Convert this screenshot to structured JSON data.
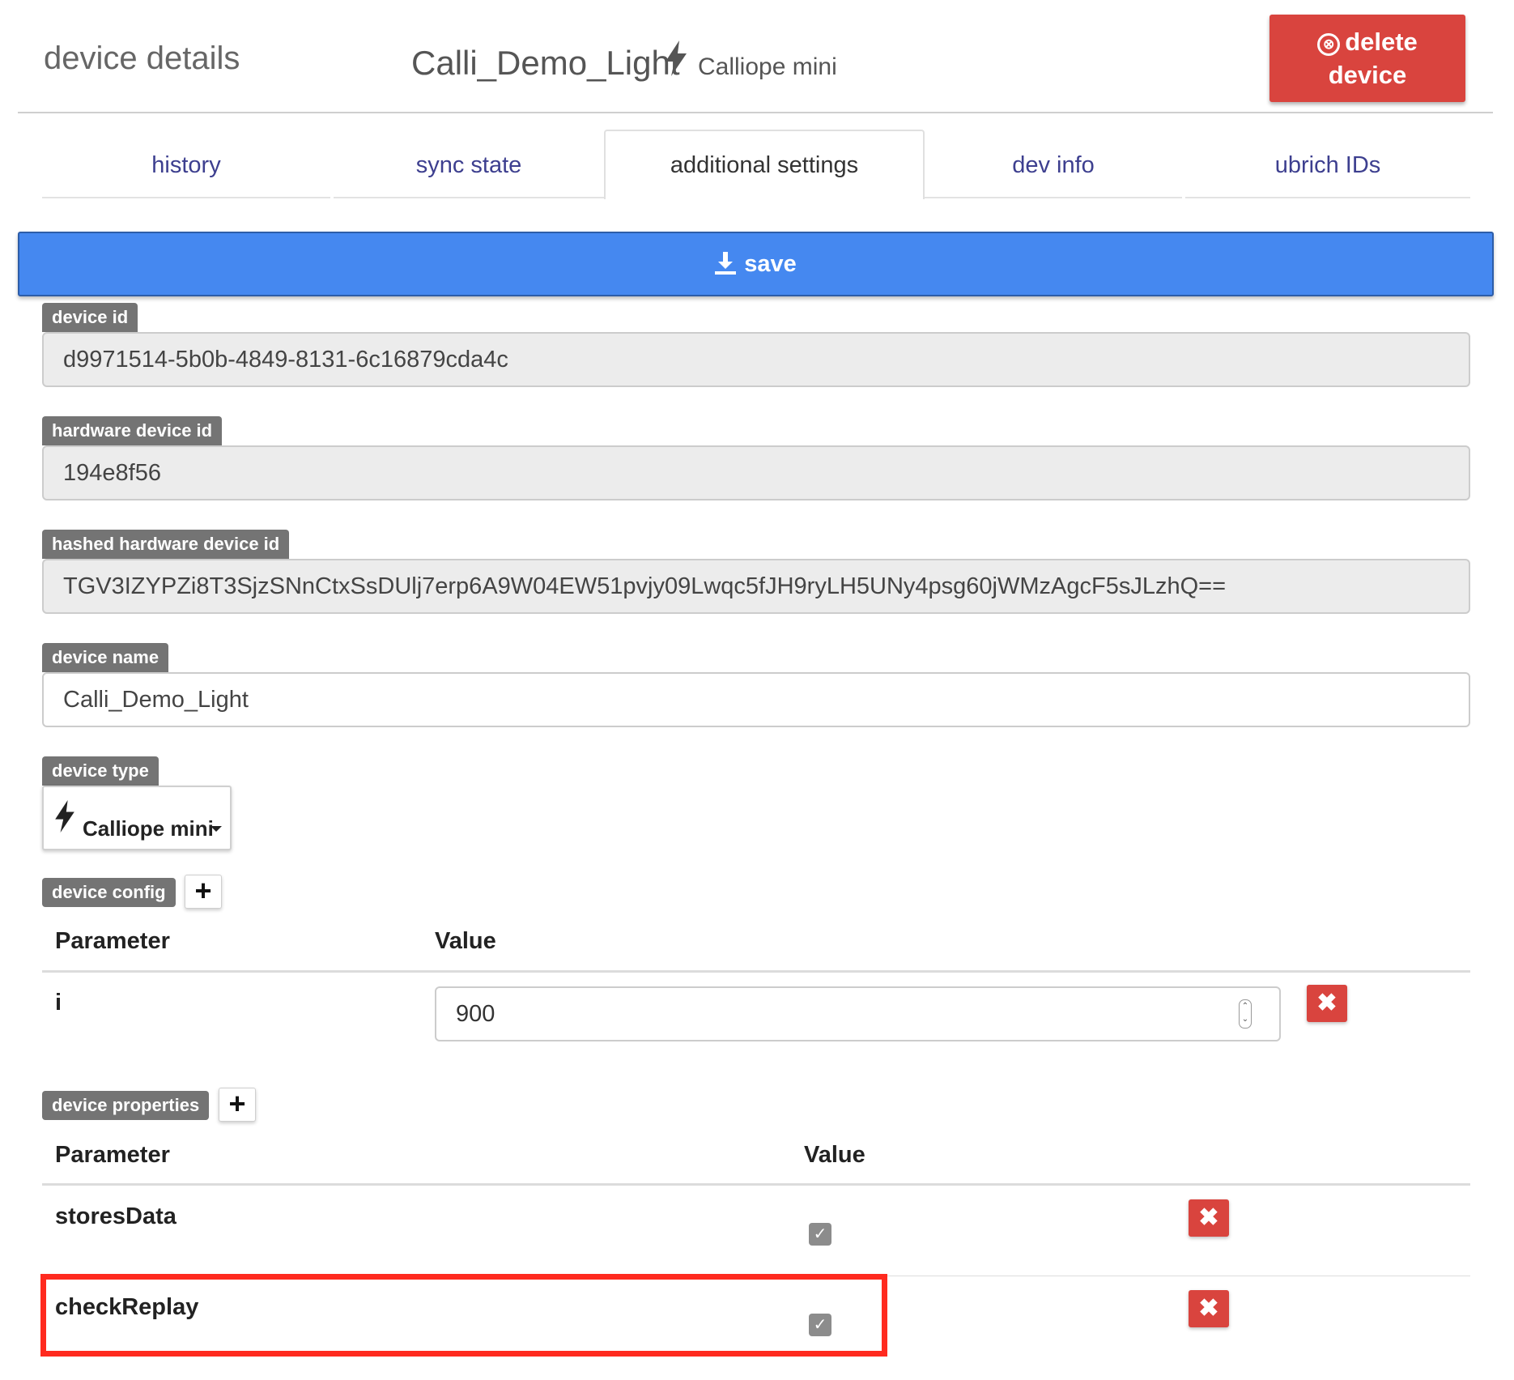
{
  "header": {
    "title": "device details",
    "device_name": "Calli_Demo_Light",
    "device_type": "Calliope mini",
    "delete_icon": "⊗",
    "delete_line1": "delete",
    "delete_line2": "device"
  },
  "tabs": [
    {
      "label": "history"
    },
    {
      "label": "sync state"
    },
    {
      "label": "additional settings",
      "active": true
    },
    {
      "label": "dev info"
    },
    {
      "label": "ubrich IDs"
    }
  ],
  "save_label": "save",
  "fields": {
    "device_id": {
      "label": "device id",
      "value": "d9971514-5b0b-4849-8131-6c16879cda4c"
    },
    "hardware_device_id": {
      "label": "hardware device id",
      "value": "194e8f56"
    },
    "hashed_hardware_device_id": {
      "label": "hashed hardware device id",
      "value": "TGV3IZYPZi8T3SjzSNnCtxSsDUlj7erp6A9W04EW51pvjy09Lwqc5fJH9ryLH5UNy4psg60jWMzAgcF5sJLzhQ=="
    },
    "device_name": {
      "label": "device name",
      "value": "Calli_Demo_Light"
    },
    "device_type": {
      "label": "device type",
      "value": "Calliope mini"
    }
  },
  "device_config": {
    "label": "device config",
    "add_label": "+",
    "headers": {
      "parameter": "Parameter",
      "value": "Value"
    },
    "rows": [
      {
        "parameter": "i",
        "value": "900"
      }
    ]
  },
  "device_properties": {
    "label": "device properties",
    "add_label": "+",
    "headers": {
      "parameter": "Parameter",
      "value": "Value"
    },
    "rows": [
      {
        "parameter": "storesData",
        "checked": true
      },
      {
        "parameter": "checkReplay",
        "checked": true
      }
    ]
  },
  "glyphs": {
    "delete_row": "✖",
    "check": "✓",
    "spin_up": "⌃",
    "spin_down": "⌄"
  },
  "colors": {
    "primary": "#4588f0",
    "danger": "#d9443e",
    "label_bg": "#747474",
    "highlight": "#ff2a1f",
    "tab_text": "#3d3f8f"
  }
}
